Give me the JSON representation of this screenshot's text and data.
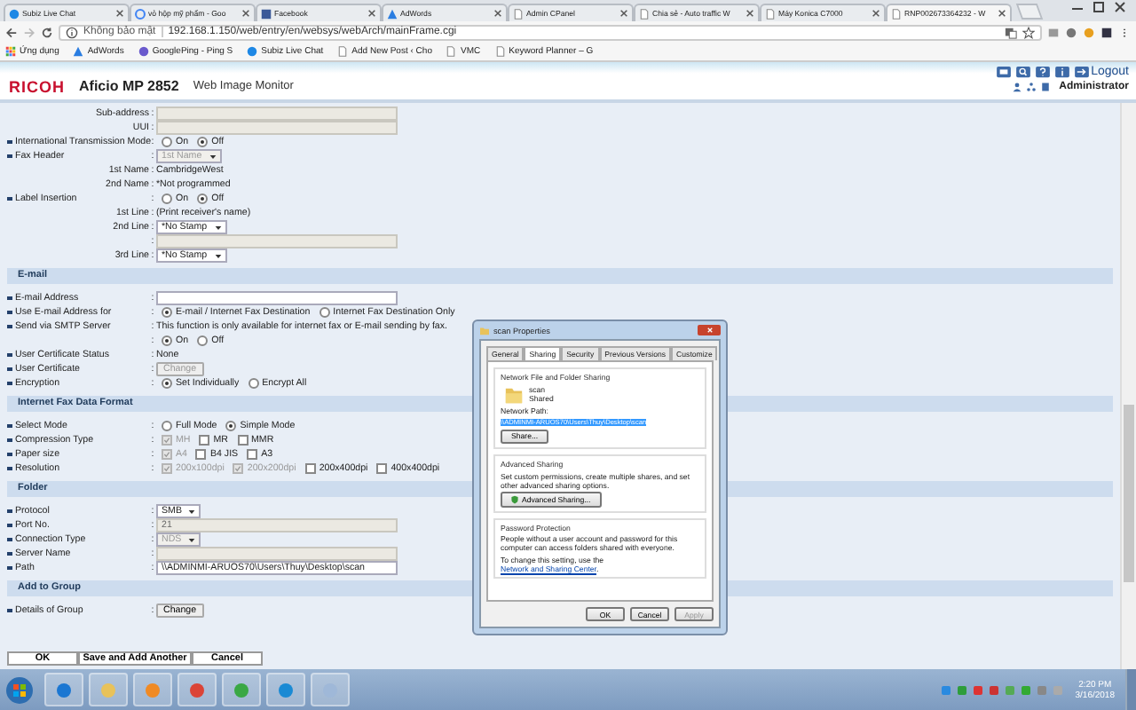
{
  "browser": {
    "tabs": [
      {
        "label": "Subiz Live Chat",
        "selected": false
      },
      {
        "label": "vỏ hộp mỹ phẩm - Goo",
        "selected": false
      },
      {
        "label": "Facebook",
        "selected": false
      },
      {
        "label": "AdWords",
        "selected": false
      },
      {
        "label": "Admin CPanel",
        "selected": false
      },
      {
        "label": "Chia sẻ - Auto traffic W",
        "selected": false
      },
      {
        "label": "Máy Konica C7000",
        "selected": false
      },
      {
        "label": "RNP002673364232 - W",
        "selected": true
      }
    ],
    "security": "Không bảo mật",
    "url": "192.168.1.150/web/entry/en/websys/webArch/mainFrame.cgi",
    "bookmarks": [
      "Ứng dụng",
      "AdWords",
      "GooglePing - Ping S",
      "Subiz Live Chat",
      "Add New Post ‹ Cho",
      "VMC",
      "Keyword Planner – G"
    ]
  },
  "header": {
    "brand": "RICOH",
    "model": "Aficio MP 2852",
    "product": "Web Image Monitor",
    "logout": "Logout",
    "user": "Administrator"
  },
  "form": {
    "sections": [
      {
        "rows": [
          {
            "label": "Sub-address",
            "sep": ":",
            "bullet": false,
            "kind": "input",
            "disabled": true
          },
          {
            "label": "UUI",
            "sep": ":",
            "bullet": false,
            "kind": "input",
            "disabled": true
          },
          {
            "label": "International Transmission Mode",
            "sep": ":",
            "bullet": true,
            "kind": "radio",
            "options": [
              {
                "label": "On",
                "selected": false
              },
              {
                "label": "Off",
                "selected": true
              }
            ]
          },
          {
            "label": "Fax Header",
            "sep": ":",
            "bullet": true,
            "kind": "select",
            "value": "1st Name",
            "disabled": true
          },
          {
            "label": "1st Name",
            "sep": ":",
            "bullet": false,
            "kind": "text",
            "value": "CambridgeWest"
          },
          {
            "label": "2nd Name",
            "sep": ":",
            "bullet": false,
            "kind": "text",
            "value": "*Not programmed"
          },
          {
            "label": "Label Insertion",
            "sep": ":",
            "bullet": true,
            "kind": "radio",
            "options": [
              {
                "label": "On",
                "selected": false
              },
              {
                "label": "Off",
                "selected": true
              }
            ]
          },
          {
            "label": "1st Line",
            "sep": ":",
            "bullet": false,
            "kind": "text",
            "value": "(Print receiver's name)"
          },
          {
            "label": "2nd Line",
            "sep": ":",
            "bullet": false,
            "kind": "select",
            "value": "*No Stamp",
            "disabled": false
          },
          {
            "sep": ":",
            "bullet": false,
            "kind": "input",
            "disabled": true
          },
          {
            "label": "3rd Line",
            "sep": ":",
            "bullet": false,
            "kind": "select",
            "value": "*No Stamp",
            "disabled": false
          }
        ]
      },
      {
        "title": "E-mail",
        "rows": [
          {
            "label": "E-mail Address",
            "sep": ":",
            "bullet": true,
            "kind": "input",
            "disabled": false
          },
          {
            "label": "Use E-mail Address for",
            "sep": ":",
            "bullet": true,
            "kind": "radio",
            "options": [
              {
                "label": "E-mail / Internet Fax Destination",
                "selected": true
              },
              {
                "label": "Internet Fax Destination Only",
                "selected": false
              }
            ]
          },
          {
            "label": "Send via SMTP Server",
            "sep": ":",
            "bullet": true,
            "kind": "text",
            "value": "This function is only available for internet fax or E-mail sending by fax."
          },
          {
            "sep": ":",
            "bullet": false,
            "kind": "radio",
            "options": [
              {
                "label": "On",
                "selected": true
              },
              {
                "label": "Off",
                "selected": false
              }
            ]
          },
          {
            "label": "User Certificate Status",
            "sep": ":",
            "bullet": true,
            "kind": "text",
            "value": "None"
          },
          {
            "label": "User Certificate",
            "sep": ":",
            "bullet": true,
            "kind": "button",
            "value": "Change",
            "disabled": true
          },
          {
            "label": "Encryption",
            "sep": ":",
            "bullet": true,
            "kind": "radio",
            "options": [
              {
                "label": "Set Individually",
                "selected": true
              },
              {
                "label": "Encrypt All",
                "selected": false
              }
            ]
          }
        ]
      },
      {
        "title": "Internet Fax Data Format",
        "rows": [
          {
            "label": "Select Mode",
            "sep": ":",
            "bullet": true,
            "kind": "radio",
            "options": [
              {
                "label": "Full Mode",
                "selected": false
              },
              {
                "label": "Simple Mode",
                "selected": true
              }
            ]
          },
          {
            "label": "Compression Type",
            "sep": ":",
            "bullet": true,
            "kind": "check",
            "options": [
              {
                "label": "MH",
                "checked": true,
                "disabled": true
              },
              {
                "label": "MR",
                "checked": false,
                "disabled": false
              },
              {
                "label": "MMR",
                "checked": false,
                "disabled": false
              }
            ]
          },
          {
            "label": "Paper size",
            "sep": ":",
            "bullet": true,
            "kind": "check",
            "options": [
              {
                "label": "A4",
                "checked": true,
                "disabled": true
              },
              {
                "label": "B4 JIS",
                "checked": false,
                "disabled": false
              },
              {
                "label": "A3",
                "checked": false,
                "disabled": false
              }
            ]
          },
          {
            "label": "Resolution",
            "sep": ":",
            "bullet": true,
            "kind": "check",
            "options": [
              {
                "label": "200x100dpi",
                "checked": true,
                "disabled": true
              },
              {
                "label": "200x200dpi",
                "checked": true,
                "disabled": true
              },
              {
                "label": "200x400dpi",
                "checked": false,
                "disabled": false
              },
              {
                "label": "400x400dpi",
                "checked": false,
                "disabled": false
              }
            ]
          }
        ]
      },
      {
        "title": "Folder",
        "rows": [
          {
            "label": "Protocol",
            "sep": ":",
            "bullet": true,
            "kind": "select",
            "value": "SMB",
            "disabled": false
          },
          {
            "label": "Port No.",
            "sep": ":",
            "bullet": true,
            "kind": "input",
            "value": "21",
            "disabled": true
          },
          {
            "label": "Connection Type",
            "sep": ":",
            "bullet": true,
            "kind": "select",
            "value": "NDS",
            "disabled": true
          },
          {
            "label": "Server Name",
            "sep": ":",
            "bullet": true,
            "kind": "input",
            "disabled": true
          },
          {
            "label": "Path",
            "sep": ":",
            "bullet": true,
            "kind": "input",
            "value": "\\\\ADMINMI-ARUOS70\\Users\\Thuy\\Desktop\\scan",
            "disabled": false
          }
        ]
      },
      {
        "title": "Add to Group",
        "rows": [
          {
            "label": "Details of Group",
            "sep": ":",
            "bullet": true,
            "kind": "button",
            "value": "Change",
            "disabled": false
          }
        ]
      }
    ]
  },
  "actions": [
    "OK",
    "Save and Add Another",
    "Cancel"
  ],
  "dialog": {
    "title": "scan Properties",
    "tabs": [
      {
        "label": "General",
        "selected": false
      },
      {
        "label": "Sharing",
        "selected": true
      },
      {
        "label": "Security",
        "selected": false
      },
      {
        "label": "Previous Versions",
        "selected": false
      },
      {
        "label": "Customize",
        "selected": false
      }
    ],
    "sharing": {
      "heading": "Network File and Folder Sharing",
      "folder_name": "scan",
      "folder_status": "Shared",
      "path_label": "Network Path:",
      "path": "\\\\ADMINMI-ARUOS70\\Users\\Thuy\\Desktop\\scan",
      "button": "Share..."
    },
    "advanced": {
      "heading": "Advanced Sharing",
      "text": "Set custom permissions, create multiple shares, and set other advanced sharing options.",
      "button": "Advanced Sharing..."
    },
    "password": {
      "heading": "Password Protection",
      "text": "People without a user account and password for this computer can access folders shared with everyone.",
      "link_before": "To change this setting, use the",
      "link": "Network and Sharing Center",
      "link_after": "."
    },
    "buttons": [
      {
        "label": "OK",
        "disabled": false
      },
      {
        "label": "Cancel",
        "disabled": false
      },
      {
        "label": "Apply",
        "disabled": true
      }
    ]
  },
  "taskbar": {
    "time": "2:20 PM",
    "date": "3/16/2018"
  }
}
